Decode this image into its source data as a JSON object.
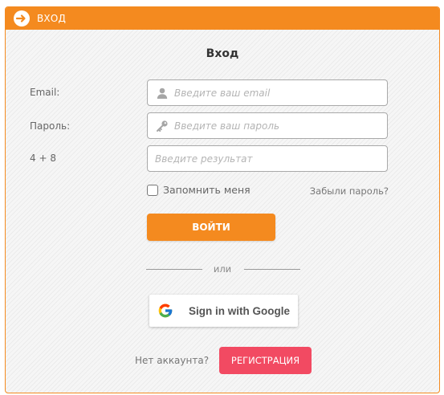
{
  "header": {
    "title": "ВХОД",
    "icon": "login-arrow-icon"
  },
  "form": {
    "title": "Вход",
    "email": {
      "label": "Email:",
      "placeholder": "Введите ваш email",
      "icon": "user-icon"
    },
    "password": {
      "label": "Пароль:",
      "placeholder": "Введите ваш пароль",
      "icon": "key-icon"
    },
    "captcha": {
      "label": "4 + 8",
      "placeholder": "Введите результат"
    },
    "remember_label": "Запомнить меня",
    "forgot_link": "Забыли пароль?",
    "login_button": "ВОЙТИ",
    "divider_text": "или",
    "google_button": "Sign in with Google",
    "no_account_text": "Нет аккаунта?",
    "register_button": "РЕГИСТРАЦИЯ"
  },
  "colors": {
    "accent": "#f48a1f",
    "register": "#f24a62"
  }
}
